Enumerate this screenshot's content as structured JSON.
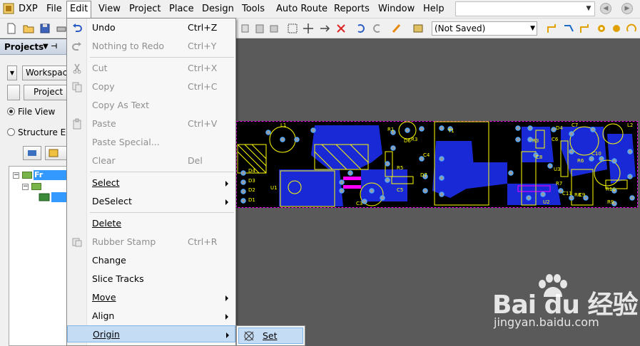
{
  "menubar": {
    "logo_text": "DXP",
    "items": [
      "File",
      "Edit",
      "View",
      "Project",
      "Place",
      "Design",
      "Tools",
      "Auto Route",
      "Reports",
      "Window",
      "Help"
    ]
  },
  "toolbar": {
    "saved_state": "(Not Saved)"
  },
  "panel": {
    "title": "Projects",
    "workspace_button": "Workspace",
    "project_button": "Project",
    "file_view": "File View",
    "structure_editor": "Structure Edi",
    "tree_root": "Fr"
  },
  "edit_menu": {
    "items": [
      {
        "label": "Undo",
        "shortcut": "Ctrl+Z",
        "disabled": false
      },
      {
        "label": "Nothing to Redo",
        "shortcut": "Ctrl+Y",
        "disabled": true
      },
      {
        "label": "Cut",
        "shortcut": "Ctrl+X",
        "disabled": true
      },
      {
        "label": "Copy",
        "shortcut": "Ctrl+C",
        "disabled": true
      },
      {
        "label": "Copy As Text",
        "shortcut": "",
        "disabled": true
      },
      {
        "label": "Paste",
        "shortcut": "Ctrl+V",
        "disabled": true
      },
      {
        "label": "Paste Special...",
        "shortcut": "",
        "disabled": true
      },
      {
        "label": "Clear",
        "shortcut": "Del",
        "disabled": true
      },
      {
        "label": "Select",
        "shortcut": "",
        "disabled": false
      },
      {
        "label": "DeSelect",
        "shortcut": "",
        "disabled": false
      },
      {
        "label": "Delete",
        "shortcut": "",
        "disabled": false
      },
      {
        "label": "Rubber Stamp",
        "shortcut": "Ctrl+R",
        "disabled": true
      },
      {
        "label": "Change",
        "shortcut": "",
        "disabled": false
      },
      {
        "label": "Slice Tracks",
        "shortcut": "",
        "disabled": false
      },
      {
        "label": "Move",
        "shortcut": "",
        "disabled": false
      },
      {
        "label": "Align",
        "shortcut": "",
        "disabled": false
      },
      {
        "label": "Origin",
        "shortcut": "",
        "disabled": false
      }
    ]
  },
  "origin_submenu": {
    "set_label": "Set"
  },
  "pcb": {
    "labels": [
      "L1",
      "R1",
      "R2",
      "R3",
      "R4",
      "R5",
      "R6",
      "R7",
      "R8",
      "R9",
      "R10",
      "D1",
      "D2",
      "D3",
      "D4",
      "D5",
      "D6",
      "D7",
      "C1",
      "C2",
      "C3",
      "C4",
      "C5",
      "C6",
      "C7",
      "C8",
      "C9",
      "C10",
      "C11",
      "U1",
      "U2",
      "U3",
      "T1",
      "L2"
    ],
    "colors": {
      "board": "#000000",
      "copper": "#1a29d6",
      "overlay": "#ffff00",
      "pad": "#9a9a9a",
      "outline": "#ff00ff"
    }
  },
  "watermark": {
    "brand": "Bai du 经验",
    "url": "jingyan.baidu.com"
  }
}
